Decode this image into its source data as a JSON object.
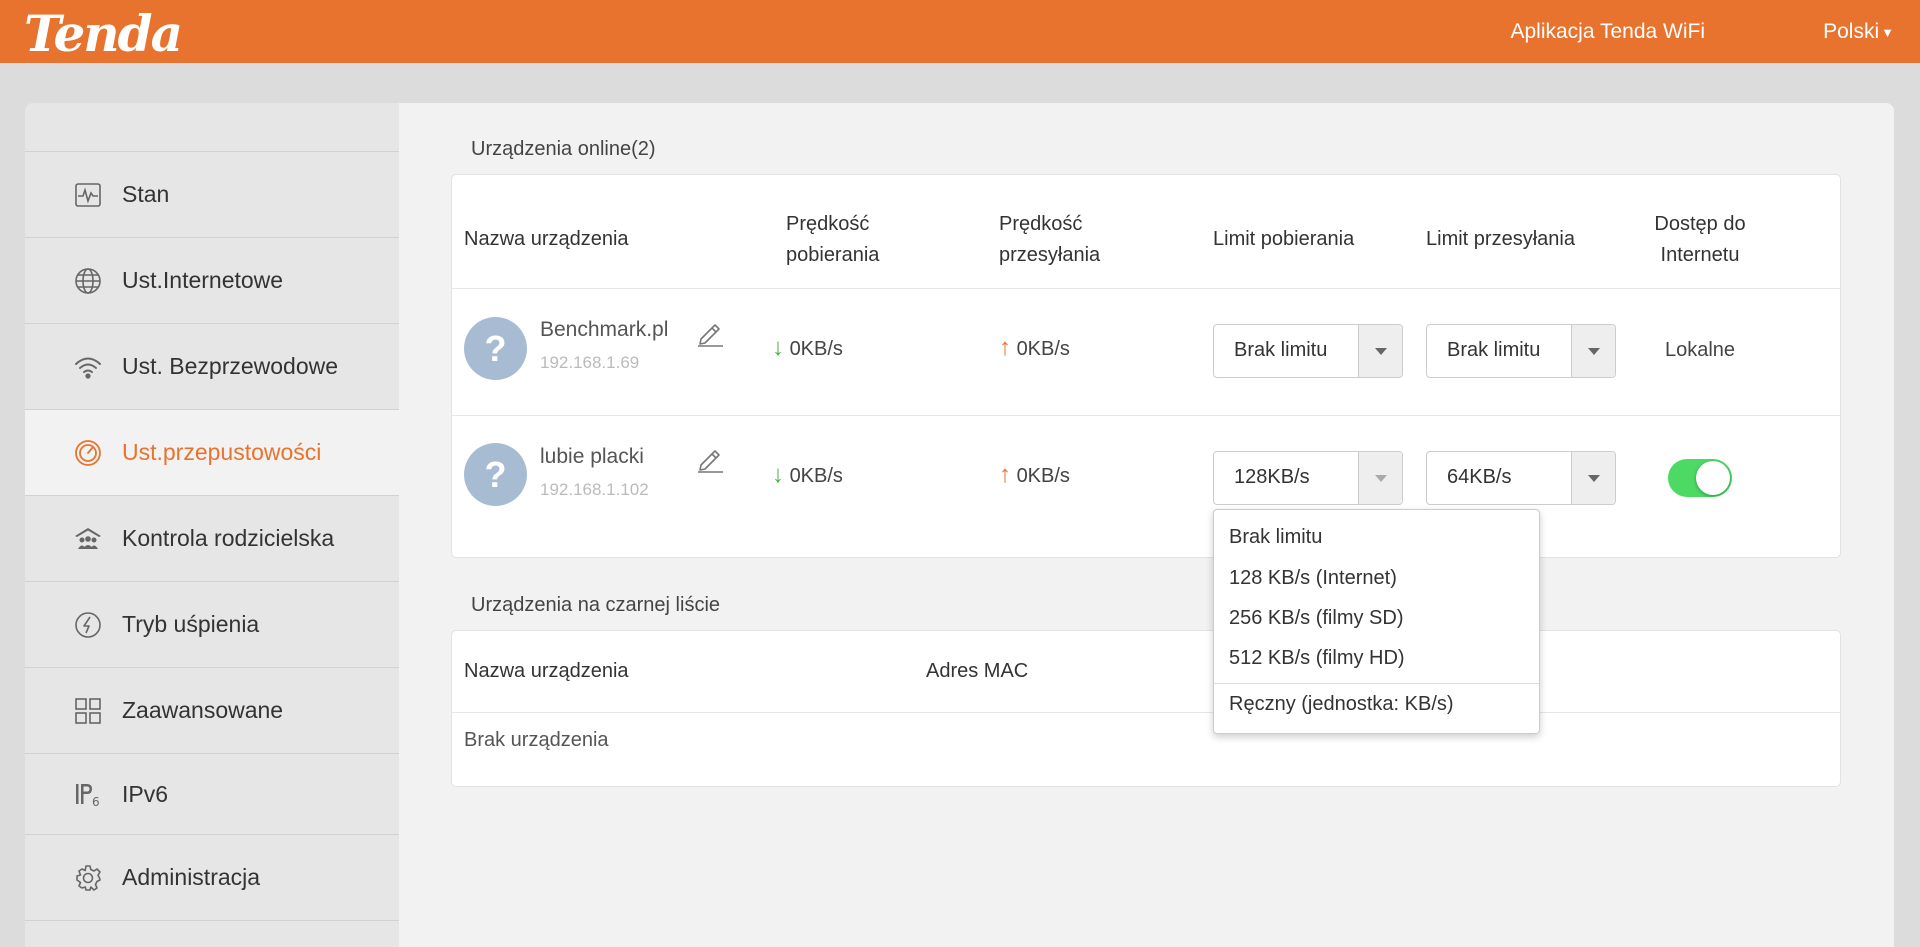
{
  "header": {
    "logo": "Tenda",
    "app_link": "Aplikacja Tenda WiFi",
    "language": "Polski",
    "accent_color": "#e8732e"
  },
  "sidebar": {
    "items": [
      {
        "label": "Stan",
        "icon": "pulse-icon"
      },
      {
        "label": "Ust.Internetowe",
        "icon": "globe-icon"
      },
      {
        "label": "Ust. Bezprzewodowe",
        "icon": "wifi-icon"
      },
      {
        "label": "Ust.przepustowości",
        "icon": "speedometer-icon",
        "active": true
      },
      {
        "label": "Kontrola rodzicielska",
        "icon": "family-icon"
      },
      {
        "label": "Tryb uśpienia",
        "icon": "sleep-icon"
      },
      {
        "label": "Zaawansowane",
        "icon": "grid-icon"
      },
      {
        "label": "IPv6",
        "icon": "ipv6-icon"
      },
      {
        "label": "Administracja",
        "icon": "gear-icon"
      }
    ]
  },
  "online": {
    "title": "Urządzenia online(2)",
    "headers": {
      "name": "Nazwa urządzenia",
      "down_speed_1": "Prędkość",
      "down_speed_2": "pobierania",
      "up_speed_1": "Prędkość",
      "up_speed_2": "przesyłania",
      "down_limit": "Limit pobierania",
      "up_limit": "Limit przesyłania",
      "access_1": "Dostęp do",
      "access_2": "Internetu"
    },
    "devices": [
      {
        "name": "Benchmark.pl",
        "ip": "192.168.1.69",
        "down_arrow": "↓",
        "down": "0KB/s",
        "up_arrow": "↑",
        "up": "0KB/s",
        "down_limit": "Brak limitu",
        "up_limit": "Brak limitu",
        "access": "Lokalne"
      },
      {
        "name": "lubie placki",
        "ip": "192.168.1.102",
        "down_arrow": "↓",
        "down": "0KB/s",
        "up_arrow": "↑",
        "up": "0KB/s",
        "down_limit": "128KB/s",
        "up_limit": "64KB/s",
        "access_enabled": true
      }
    ]
  },
  "blacklist": {
    "title": "Urządzenia na czarnej liście",
    "headers": {
      "name": "Nazwa urządzenia",
      "mac": "Adres MAC"
    },
    "empty": "Brak urządzenia"
  },
  "dropdown": {
    "options": [
      "Brak limitu",
      "128 KB/s (Internet)",
      "256 KB/s (filmy SD)",
      "512 KB/s (filmy HD)",
      "Ręczny (jednostka: KB/s)"
    ]
  }
}
